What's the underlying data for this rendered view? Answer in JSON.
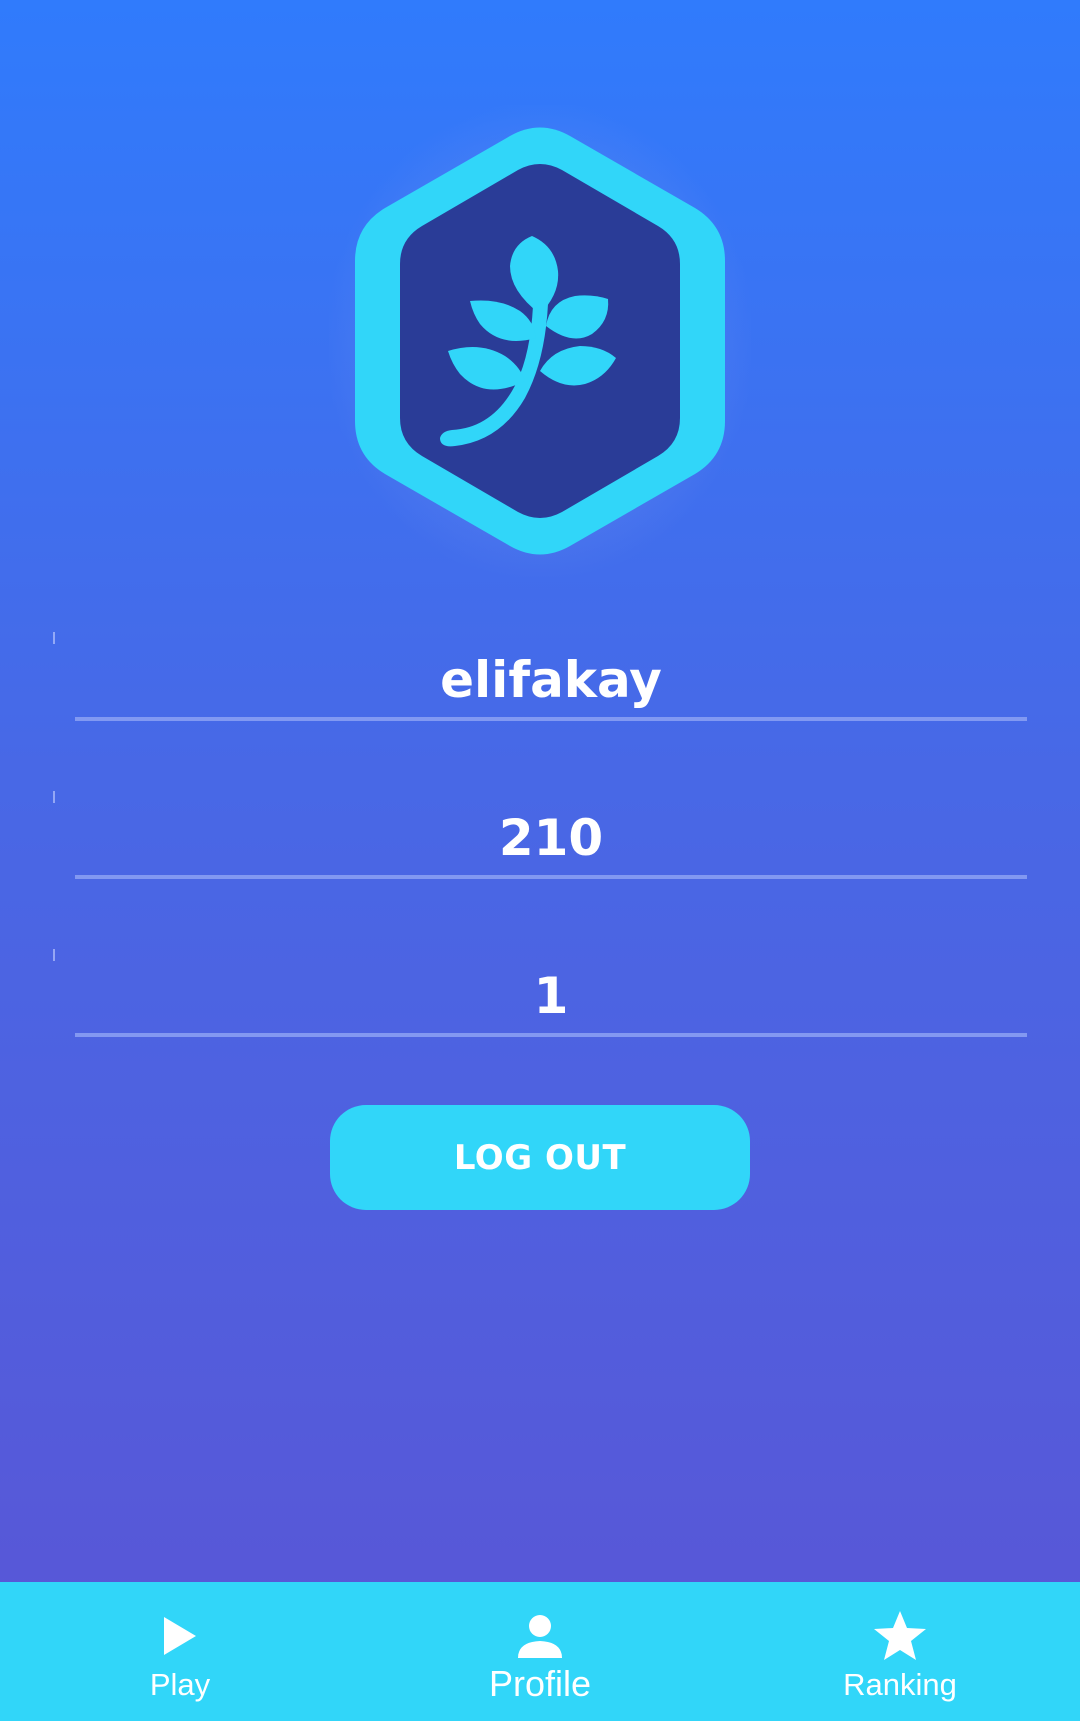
{
  "profile": {
    "badge_icon": "leaf-badge-icon",
    "username": "elifakay",
    "score": "210",
    "level": "1"
  },
  "actions": {
    "logout_label": "LOG OUT"
  },
  "nav": {
    "items": [
      {
        "label": "Play",
        "icon": "play-icon",
        "active": false
      },
      {
        "label": "Profile",
        "icon": "person-icon",
        "active": true
      },
      {
        "label": "Ranking",
        "icon": "star-icon",
        "active": false
      }
    ]
  },
  "colors": {
    "accent": "#31d6f9",
    "badge_inner": "#2a3c97",
    "background_top": "#307bfc",
    "background_bottom": "#5a55d5"
  }
}
